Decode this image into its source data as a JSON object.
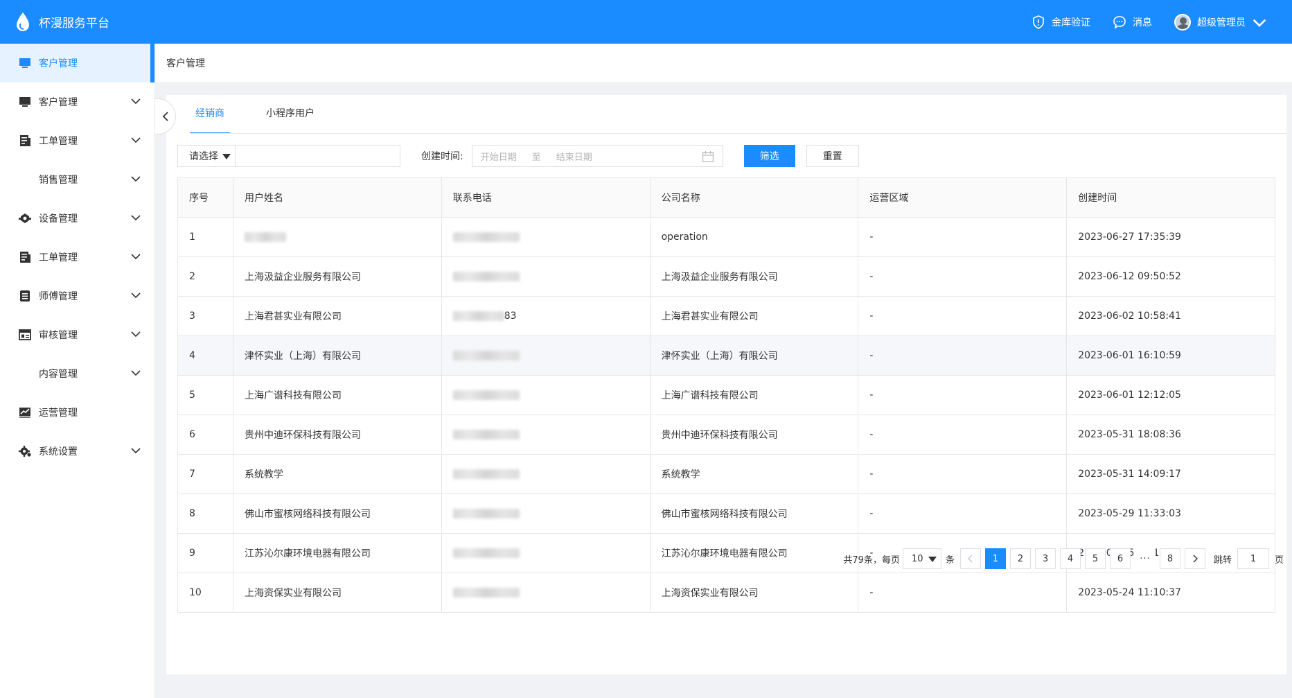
{
  "header": {
    "app_title": "杯漫服务平台",
    "items": [
      {
        "label": "金库验证",
        "icon": "shield-icon"
      },
      {
        "label": "消息",
        "icon": "chat-icon"
      },
      {
        "label": "超级管理员",
        "icon": "avatar"
      }
    ],
    "brand_color": "#1a8cff"
  },
  "sidebar": {
    "items": [
      {
        "label": "客户管理",
        "icon": "monitor-icon",
        "active": true
      },
      {
        "label": "客户管理",
        "icon": "monitor-icon"
      },
      {
        "label": "工单管理",
        "icon": "document-icon"
      },
      {
        "label": "销售管理",
        "icon": ""
      },
      {
        "label": "设备管理",
        "icon": "device-icon"
      },
      {
        "label": "工单管理",
        "icon": "document-icon"
      },
      {
        "label": "师傅管理",
        "icon": "list-icon"
      },
      {
        "label": "审核管理",
        "icon": "review-icon"
      },
      {
        "label": "内容管理",
        "icon": ""
      },
      {
        "label": "运营管理",
        "icon": "chart-icon"
      },
      {
        "label": "系统设置",
        "icon": "gear-icon"
      }
    ]
  },
  "breadcrumb": "客户管理",
  "tabs": [
    "经销商",
    "小程序用户"
  ],
  "filter": {
    "select_placeholder": "请选择",
    "created_label": "创建时间:",
    "start_placeholder": "开始日期",
    "range_sep": "至",
    "end_placeholder": "结束日期",
    "filter_button": "筛选",
    "reset_button": "重置"
  },
  "table": {
    "headers": [
      "序号",
      "用户姓名",
      "联系电话",
      "公司名称",
      "运营区域",
      "创建时间"
    ],
    "rows": [
      {
        "index": "1",
        "name": "",
        "phone": "",
        "company": "operation",
        "region": "-",
        "created": "2023-06-27 17:35:39"
      },
      {
        "index": "2",
        "name": "上海汲益企业服务有限公司",
        "phone": "",
        "company": "上海汲益企业服务有限公司",
        "region": "-",
        "created": "2023-06-12 09:50:52"
      },
      {
        "index": "3",
        "name": "上海君甚实业有限公司",
        "phone": "83",
        "company": "上海君甚实业有限公司",
        "region": "-",
        "created": "2023-06-02 10:58:41"
      },
      {
        "index": "4",
        "name": "津怀实业（上海）有限公司",
        "phone": "",
        "company": "津怀实业（上海）有限公司",
        "region": "-",
        "created": "2023-06-01 16:10:59"
      },
      {
        "index": "5",
        "name": "上海广谱科技有限公司",
        "phone": "",
        "company": "上海广谱科技有限公司",
        "region": "-",
        "created": "2023-06-01 12:12:05"
      },
      {
        "index": "6",
        "name": "贵州中迪环保科技有限公司",
        "phone": "",
        "company": "贵州中迪环保科技有限公司",
        "region": "-",
        "created": "2023-05-31 18:08:36"
      },
      {
        "index": "7",
        "name": "系统教学",
        "phone": "",
        "company": "系统教学",
        "region": "-",
        "created": "2023-05-31 14:09:17"
      },
      {
        "index": "8",
        "name": "佛山市蜜核网络科技有限公司",
        "phone": "",
        "company": "佛山市蜜核网络科技有限公司",
        "region": "-",
        "created": "2023-05-29 11:33:03"
      },
      {
        "index": "9",
        "name": "江苏沁尔康环境电器有限公司",
        "phone": "",
        "company": "江苏沁尔康环境电器有限公司",
        "region": "-",
        "created": "2023-05-25 17:16:11"
      },
      {
        "index": "10",
        "name": "上海资保实业有限公司",
        "phone": "",
        "company": "上海资保实业有限公司",
        "region": "-",
        "created": "2023-05-24 11:10:37"
      }
    ]
  },
  "pagination": {
    "total_text": "共79条，每页",
    "page_size": "10",
    "unit": "条",
    "pages": [
      "1",
      "2",
      "3",
      "4",
      "5",
      "6",
      "···",
      "8"
    ],
    "current": "1",
    "jump_label": "跳转",
    "jump_value": "1",
    "jump_suffix": "页"
  }
}
